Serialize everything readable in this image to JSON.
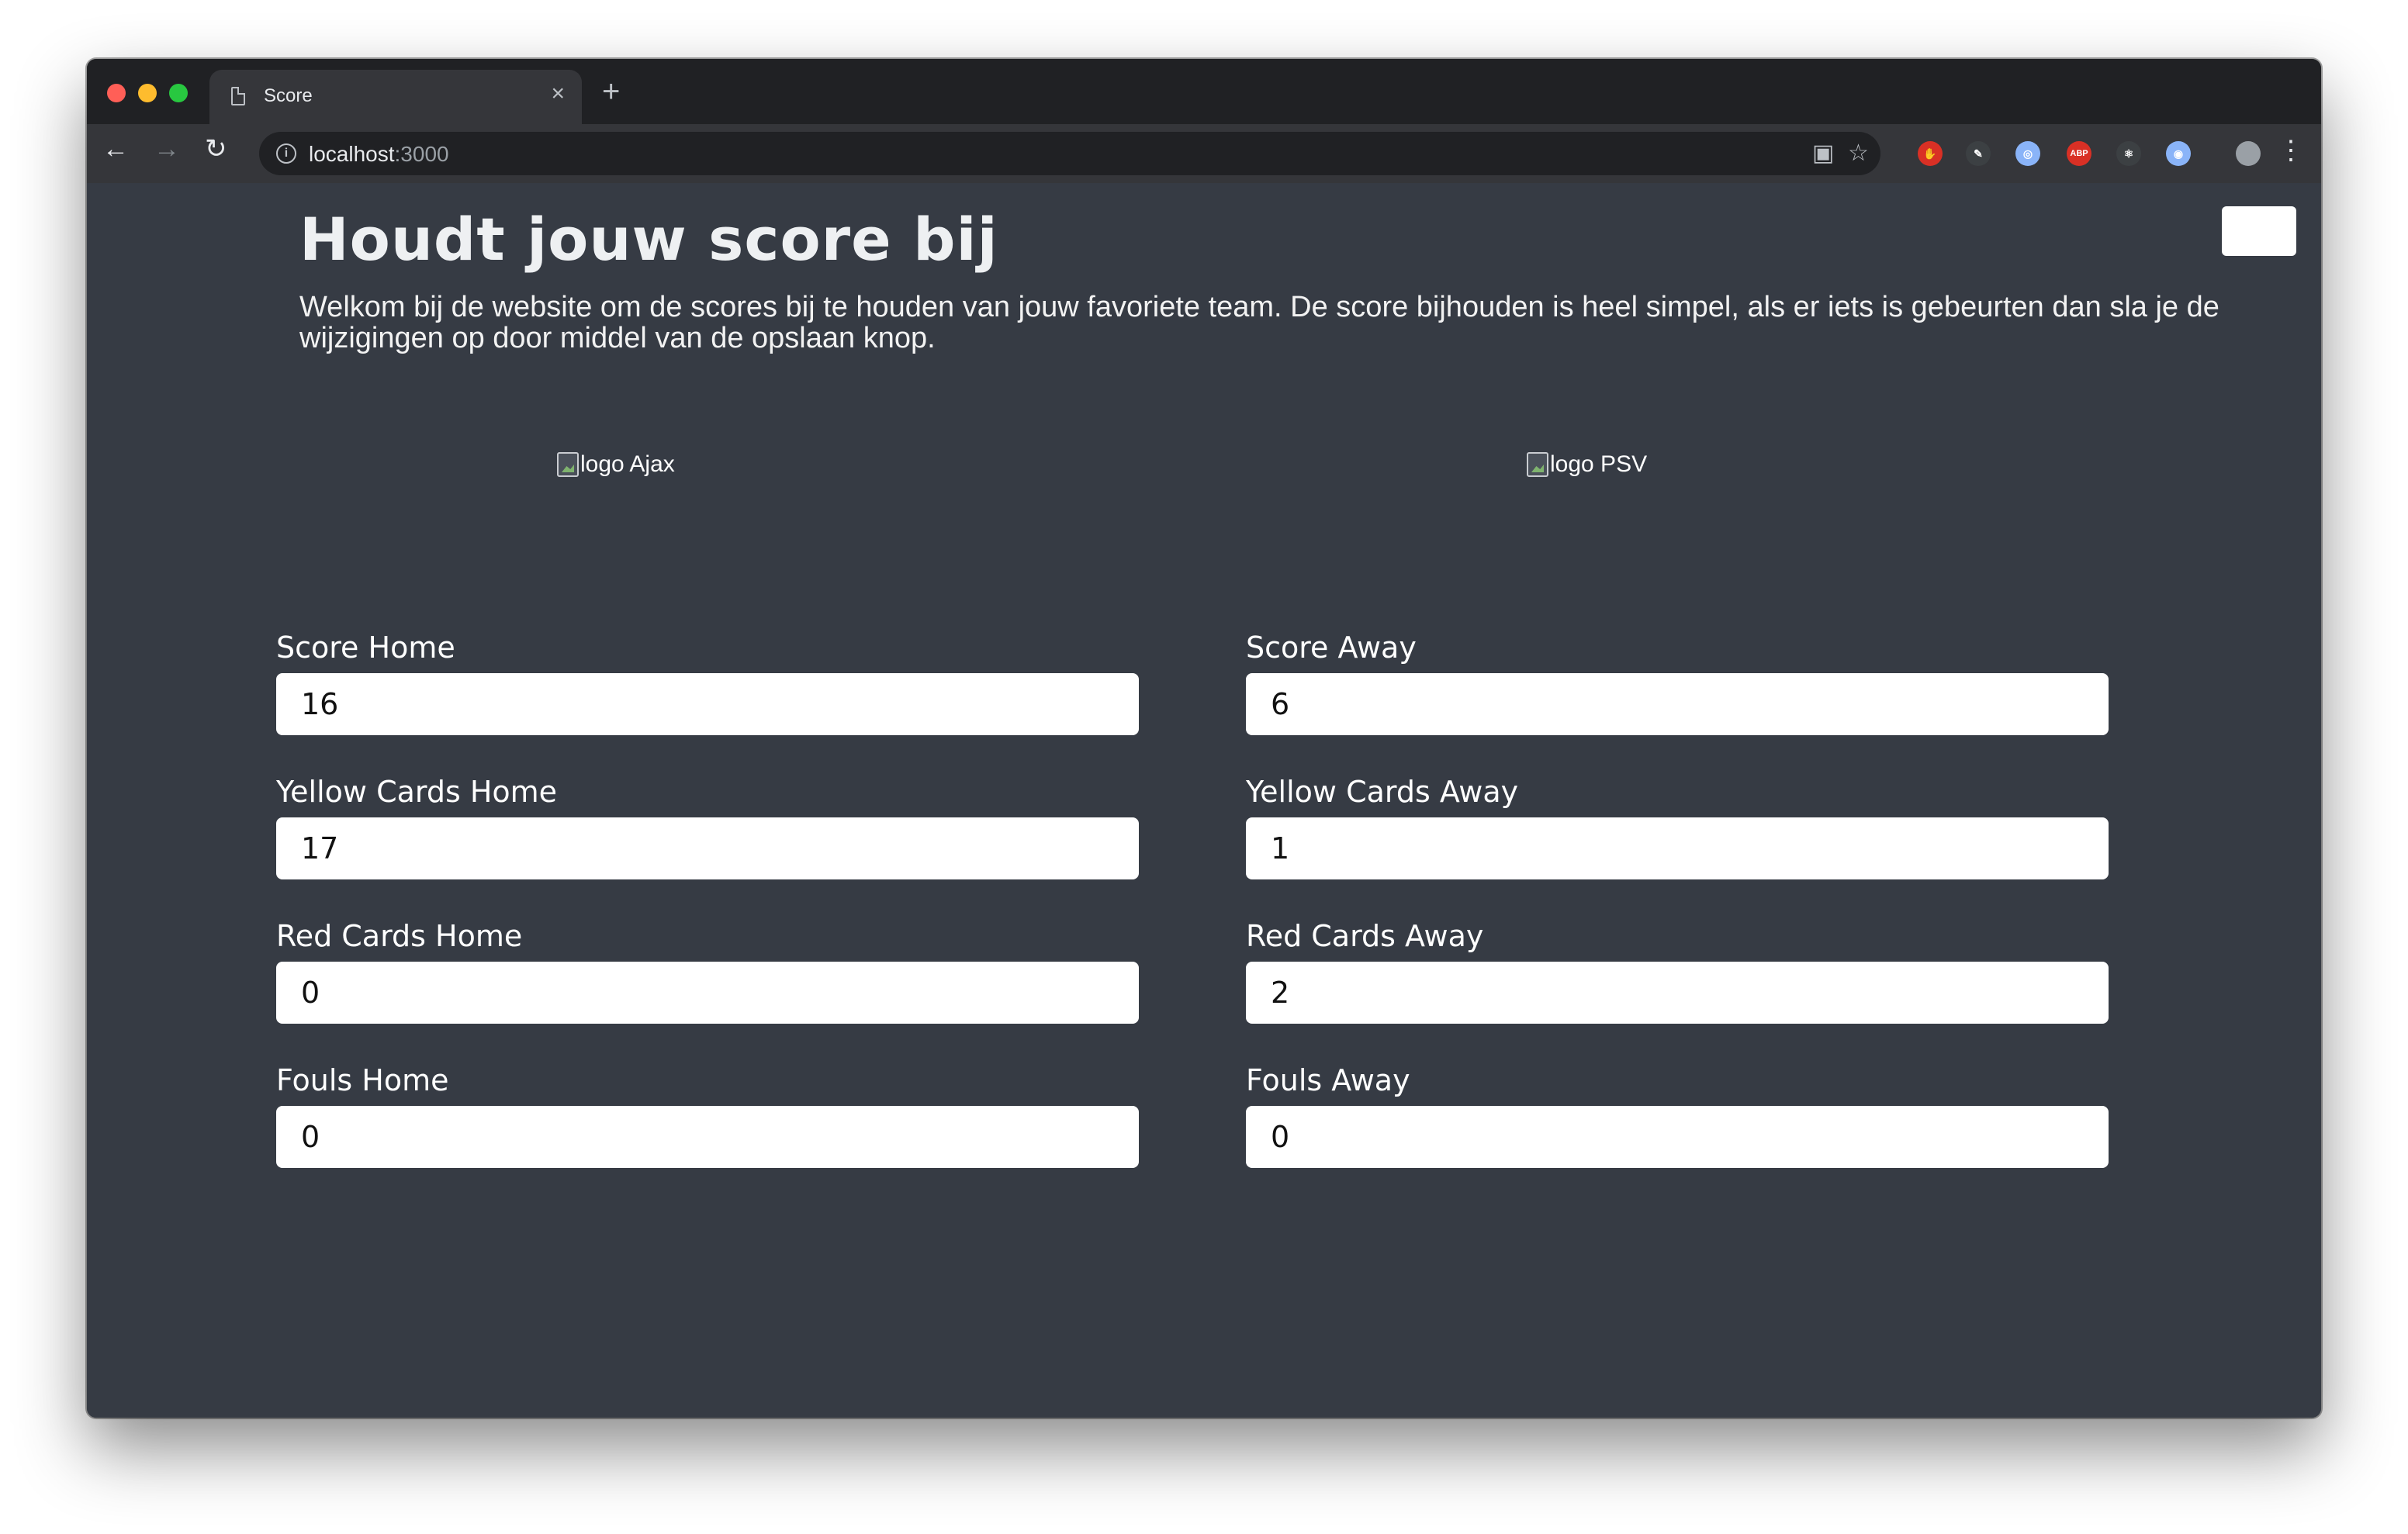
{
  "browser": {
    "tab_title": "Score",
    "tab_close": "×",
    "new_tab": "+",
    "url_host": "localhost",
    "url_port": ":3000",
    "nav_back": "←",
    "nav_forward": "→",
    "nav_reload": "↻",
    "menu": "⋮",
    "extensions": [
      {
        "name": "stop-extension-icon",
        "label": "✋",
        "color": "#d93025"
      },
      {
        "name": "pen-extension-icon",
        "label": "✎",
        "color": "#3c4043"
      },
      {
        "name": "circle-extension-icon",
        "label": "◎",
        "color": "#8ab4f8"
      },
      {
        "name": "adblock-extension-icon",
        "label": "ABP",
        "color": "#d93025"
      },
      {
        "name": "react-extension-icon",
        "label": "⚛",
        "color": "#3c4043"
      },
      {
        "name": "ring-extension-icon",
        "label": "◉",
        "color": "#8ab4f8"
      }
    ]
  },
  "page": {
    "title": "Houdt jouw score bij",
    "intro": "Welkom bij de website om de scores bij te houden van jouw favoriete team. De score bijhouden is heel simpel, als er iets is gebeurten dan sla je de wijzigingen op door middel van de opslaan knop.",
    "logo_home_alt": "logo Ajax",
    "logo_away_alt": "logo PSV"
  },
  "home": {
    "score": {
      "label": "Score Home",
      "value": "16"
    },
    "yellow": {
      "label": "Yellow Cards Home",
      "value": "17"
    },
    "red": {
      "label": "Red Cards Home",
      "value": "0"
    },
    "fouls": {
      "label": "Fouls Home",
      "value": "0"
    }
  },
  "away": {
    "score": {
      "label": "Score Away",
      "value": "6"
    },
    "yellow": {
      "label": "Yellow Cards Away",
      "value": "1"
    },
    "red": {
      "label": "Red Cards Away",
      "value": "2"
    },
    "fouls": {
      "label": "Fouls Away",
      "value": "0"
    }
  },
  "colors": {
    "page_background": "#363b44",
    "browser_frame": "#202124",
    "toolbar": "#35363a"
  }
}
